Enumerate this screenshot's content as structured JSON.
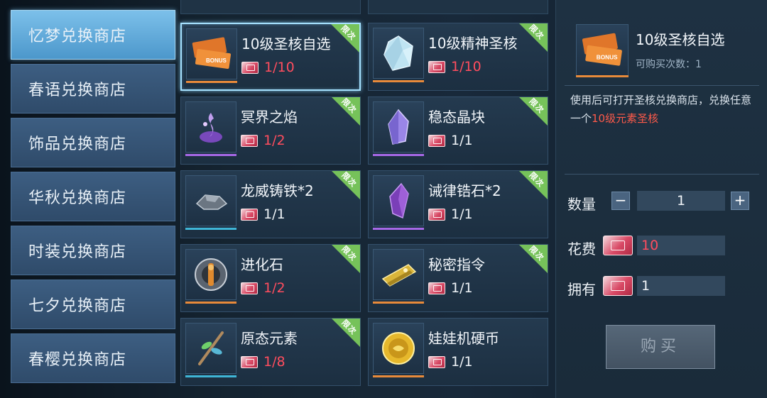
{
  "sidebar": {
    "tabs": [
      {
        "label": "忆梦兑换商店",
        "active": true
      },
      {
        "label": "春语兑换商店",
        "active": false
      },
      {
        "label": "饰品兑换商店",
        "active": false
      },
      {
        "label": "华秋兑换商店",
        "active": false
      },
      {
        "label": "时装兑换商店",
        "active": false
      },
      {
        "label": "七夕兑换商店",
        "active": false
      },
      {
        "label": "春樱兑换商店",
        "active": false
      }
    ]
  },
  "badge_label": "限次",
  "items": [
    {
      "name": "10级圣核自选",
      "limit": "1/10",
      "limit_color": "red",
      "rarity": "orange",
      "icon": "ticket-bundle-icon",
      "selected": true
    },
    {
      "name": "10级精神圣核",
      "limit": "1/10",
      "limit_color": "red",
      "rarity": "orange",
      "icon": "crystal-icon",
      "selected": false
    },
    {
      "name": "冥界之焰",
      "limit": "1/2",
      "limit_color": "red",
      "rarity": "purple",
      "icon": "purple-flame-icon",
      "selected": false
    },
    {
      "name": "稳态晶块",
      "limit": "1/1",
      "limit_color": "white",
      "rarity": "purple",
      "icon": "purple-crystal-icon",
      "selected": false
    },
    {
      "name": "龙威铸铁*2",
      "limit": "1/1",
      "limit_color": "white",
      "rarity": "cyan",
      "icon": "iron-ore-icon",
      "selected": false
    },
    {
      "name": "诫律锆石*2",
      "limit": "1/1",
      "limit_color": "white",
      "rarity": "purple",
      "icon": "zircon-icon",
      "selected": false
    },
    {
      "name": "进化石",
      "limit": "1/2",
      "limit_color": "red",
      "rarity": "orange",
      "icon": "evolution-stone-icon",
      "selected": false
    },
    {
      "name": "秘密指令",
      "limit": "1/1",
      "limit_color": "white",
      "rarity": "orange",
      "icon": "secret-order-icon",
      "selected": false
    },
    {
      "name": "原态元素",
      "limit": "1/8",
      "limit_color": "red",
      "rarity": "cyan",
      "icon": "branch-icon",
      "selected": false
    },
    {
      "name": "娃娃机硬币",
      "limit": "1/1",
      "limit_color": "white",
      "rarity": "orange",
      "icon": "gold-coin-icon",
      "selected": false
    }
  ],
  "detail": {
    "title": "10级圣核自选",
    "remain": "可购买次数：1",
    "desc_prefix": "使用后可打开圣核兑换商店，兑换任意一个",
    "desc_highlight": "10级元素圣核",
    "qty_label": "数量",
    "qty_value": "1",
    "minus": "−",
    "plus": "+",
    "cost_label": "花费",
    "cost_value": "10",
    "own_label": "拥有",
    "own_value": "1",
    "buy_label": "购买"
  },
  "colors": {
    "accent_active_tab": "#5aa8db",
    "limit_red": "#ff4d5e",
    "badge_green": "#76c25a",
    "highlight_red": "#ff5a4a"
  }
}
